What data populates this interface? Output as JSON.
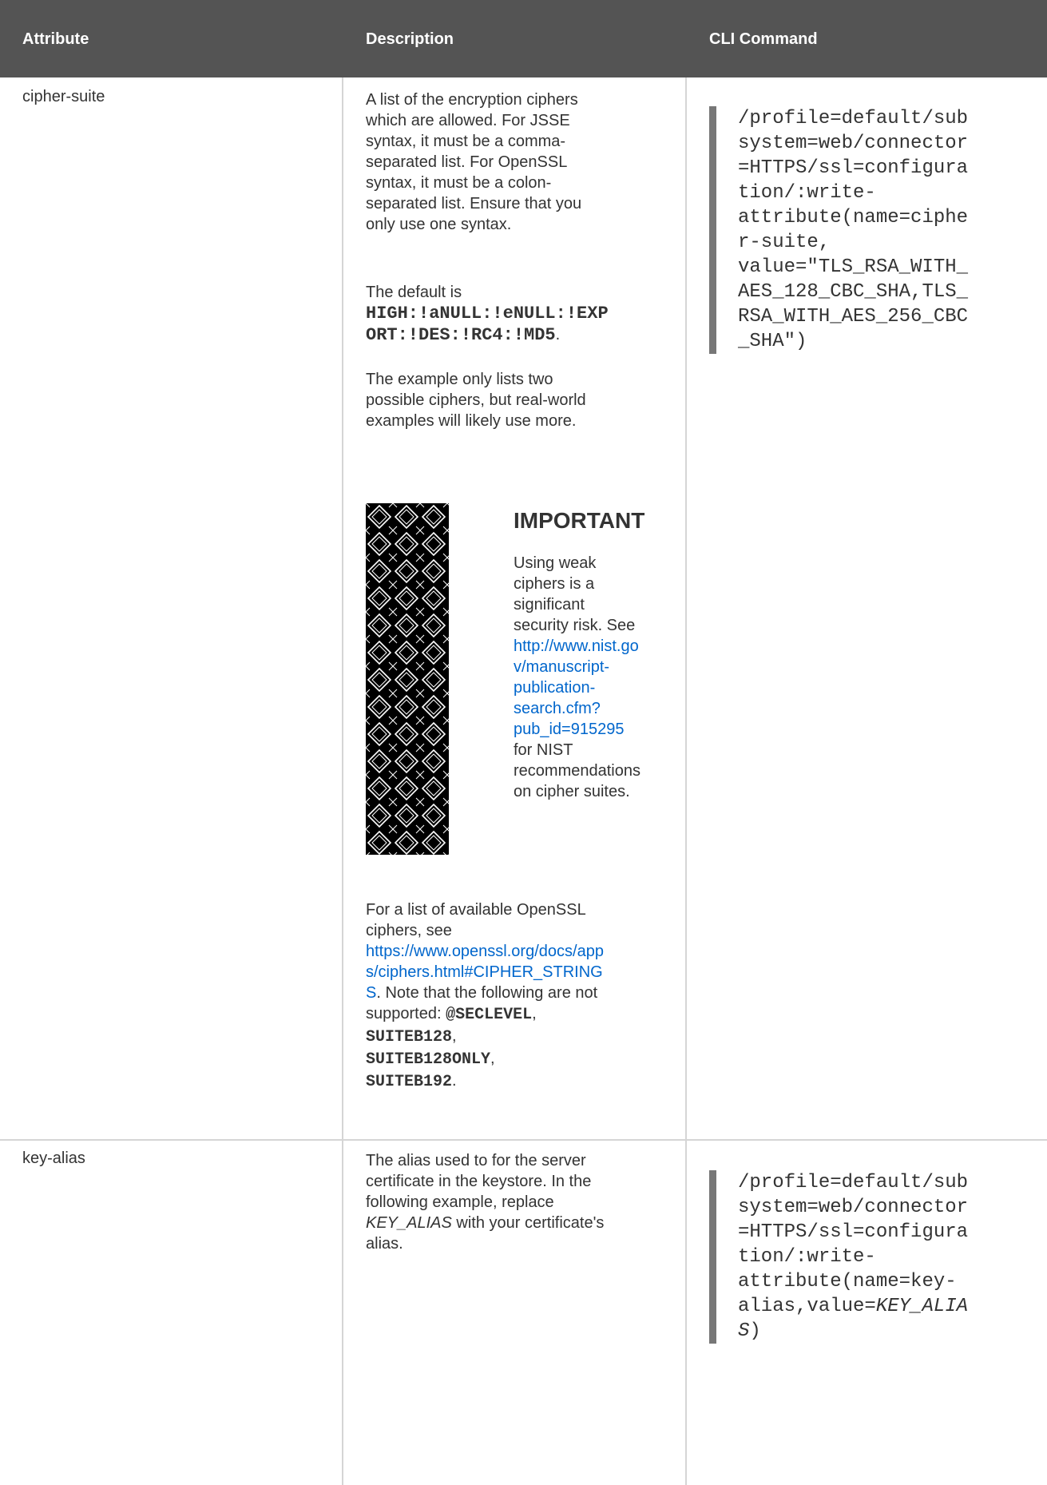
{
  "table": {
    "headers": {
      "attribute": "Attribute",
      "description": "Description",
      "cli_command": "CLI Command"
    },
    "rows": [
      {
        "attribute": "cipher-suite",
        "description": {
          "p1": [
            "A list of the encryption ciphers",
            "which are allowed. For JSSE",
            "syntax, it must be a comma-",
            "separated list. For OpenSSL",
            "syntax, it must be a colon-",
            "separated list. Ensure that you",
            "only use one syntax."
          ],
          "p2_prefix": "The default is",
          "p2_code": [
            "HIGH:!aNULL:!eNULL:!EXP",
            "ORT:!DES:!RC4:!MD5"
          ],
          "p2_suffix": ".",
          "p3": [
            "The example only lists two",
            "possible ciphers, but real-world",
            "examples will likely use more."
          ],
          "important": {
            "title": "IMPORTANT",
            "text_before": [
              "Using weak",
              "ciphers is a",
              "significant",
              "security risk. See"
            ],
            "link": [
              "http://www.nist.go",
              "v/manuscript-",
              "publication-",
              "search.cfm?",
              "pub_id=915295"
            ],
            "text_after": [
              "for NIST",
              "recommendations",
              "on cipher suites."
            ]
          },
          "p4_before": [
            "For a list of available OpenSSL",
            "ciphers, see"
          ],
          "p4_link": [
            "https://www.openssl.org/docs/app",
            "s/ciphers.html#CIPHER_STRING",
            "S"
          ],
          "p4_after": ". Note that the following are not",
          "p4_supported_prefix": "supported: ",
          "p4_codes": [
            "@SECLEVEL",
            "SUITEB128",
            "SUITEB128ONLY",
            "SUITEB192"
          ],
          "sep_comma": ",",
          "sep_period": "."
        },
        "cli": [
          "/profile=default/sub",
          "system=web/connector",
          "=HTTPS/ssl=configura",
          "tion/:write-",
          "attribute(name=ciphe",
          "r-suite,",
          "value=\"TLS_RSA_WITH_",
          "AES_128_CBC_SHA,TLS_",
          "RSA_WITH_AES_256_CBC",
          "_SHA\")"
        ]
      },
      {
        "attribute": "key-alias",
        "description": {
          "l1": "The alias used to for the server",
          "l2": "certificate in the keystore. In the",
          "l3": "following example, replace",
          "l4_italic": "KEY_ALIAS",
          "l4_rest": " with your certificate's",
          "l5": "alias."
        },
        "cli": {
          "lines": [
            "/profile=default/sub",
            "system=web/connector",
            "=HTTPS/ssl=configura",
            "tion/:write-",
            "attribute(name=key-"
          ],
          "l6_prefix": "alias,value=",
          "l6_italic": "KEY_ALIA",
          "l7_italic": "S",
          "l7_rest": ")"
        }
      }
    ]
  }
}
